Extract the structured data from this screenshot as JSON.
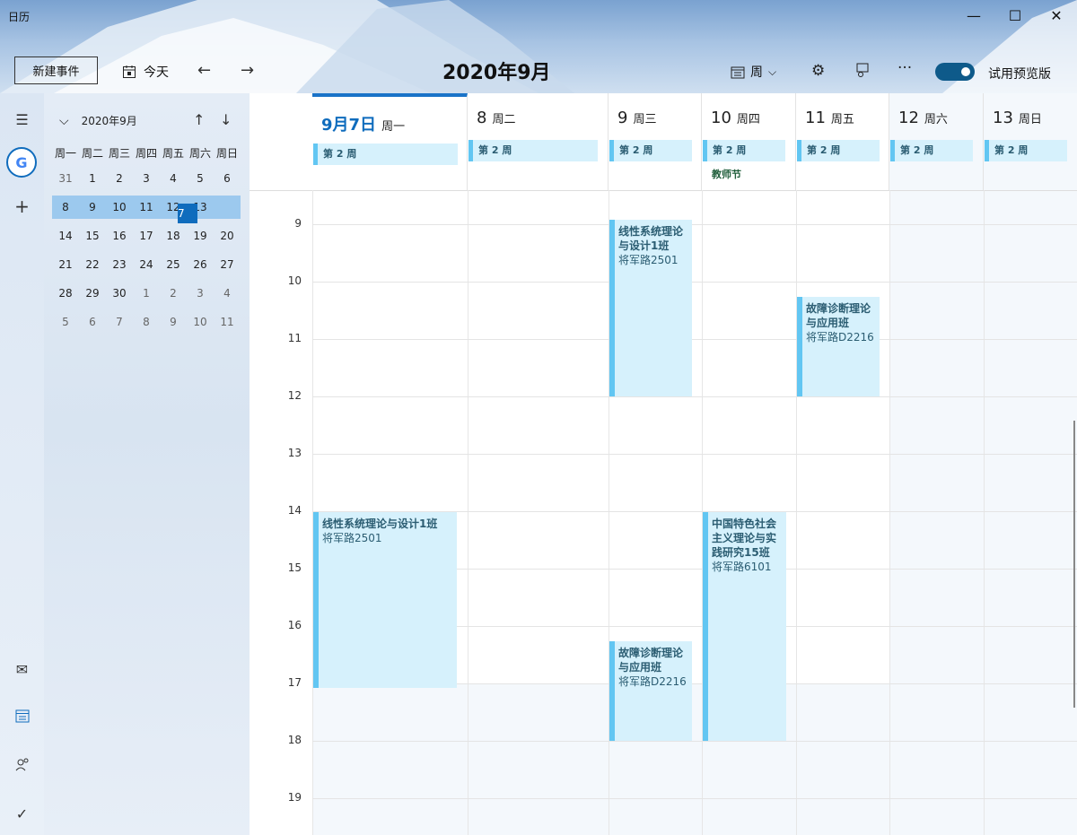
{
  "app": {
    "title": "日历"
  },
  "toolbar": {
    "new_event": "新建事件",
    "today": "今天",
    "month_title": "2020年9月",
    "view": "周",
    "preview_label": "试用预览版"
  },
  "mini_calendar": {
    "title": "2020年9月",
    "weekdays": [
      "周一",
      "周二",
      "周三",
      "周四",
      "周五",
      "周六",
      "周日"
    ],
    "weeks": [
      [
        "31",
        "1",
        "2",
        "3",
        "4",
        "5",
        "6"
      ],
      [
        "7",
        "8",
        "9",
        "10",
        "11",
        "12",
        "13"
      ],
      [
        "14",
        "15",
        "16",
        "17",
        "18",
        "19",
        "20"
      ],
      [
        "21",
        "22",
        "23",
        "24",
        "25",
        "26",
        "27"
      ],
      [
        "28",
        "29",
        "30",
        "1",
        "2",
        "3",
        "4"
      ],
      [
        "5",
        "6",
        "7",
        "8",
        "9",
        "10",
        "11"
      ]
    ]
  },
  "days": [
    {
      "date": "9月7日",
      "weekday": "周一",
      "week": "第 2 周",
      "holiday": ""
    },
    {
      "date": "8",
      "weekday": "周二",
      "week": "第 2 周",
      "holiday": ""
    },
    {
      "date": "9",
      "weekday": "周三",
      "week": "第 2 周",
      "holiday": ""
    },
    {
      "date": "10",
      "weekday": "周四",
      "week": "第 2 周",
      "holiday": "教师节"
    },
    {
      "date": "11",
      "weekday": "周五",
      "week": "第 2 周",
      "holiday": ""
    },
    {
      "date": "12",
      "weekday": "周六",
      "week": "第 2 周",
      "holiday": ""
    },
    {
      "date": "13",
      "weekday": "周日",
      "week": "第 2 周",
      "holiday": ""
    }
  ],
  "hours": [
    "9",
    "10",
    "11",
    "12",
    "13",
    "14",
    "15",
    "16",
    "17",
    "18",
    "19"
  ],
  "events": [
    {
      "title": "线性系统理论与设计1班",
      "location": "将军路2501"
    },
    {
      "title": "线性系统理论与设计1班",
      "location": "将军路2501"
    },
    {
      "title": "故障诊断理论与应用班",
      "location": "将军路D2216"
    },
    {
      "title": "中国特色社会主义理论与实践研究15班",
      "location": "将军路6101"
    },
    {
      "title": "故障诊断理论与应用班",
      "location": "将军路D2216"
    }
  ],
  "icons": {
    "menu": "menu-icon",
    "calendar": "calendar-icon",
    "settings": "gear-icon",
    "feedback": "feedback-icon",
    "more": "more-icon",
    "mail": "mail-icon",
    "people": "people-icon",
    "todo": "todo-icon",
    "add": "plus-icon"
  },
  "colors": {
    "accent": "#0f6cbd",
    "event_bg": "#d6f1fc",
    "event_bar": "#62c6f2"
  }
}
